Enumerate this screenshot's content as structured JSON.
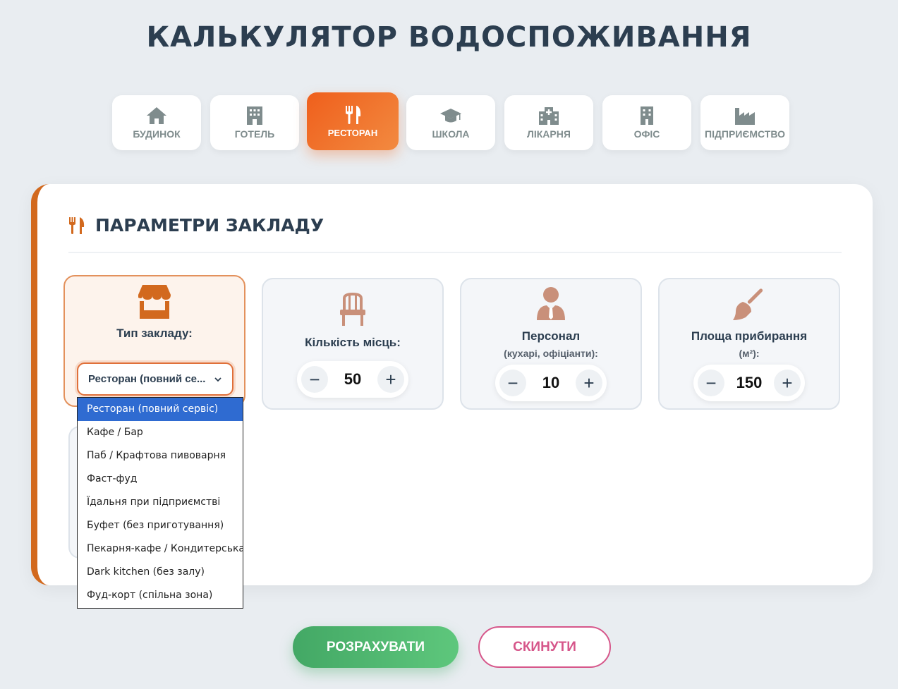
{
  "title": "КАЛЬКУЛЯТОР ВОДОСПОЖИВАННЯ",
  "tabs": [
    {
      "label": "БУДИНОК",
      "icon": "house-icon"
    },
    {
      "label": "ГОТЕЛЬ",
      "icon": "hotel-icon"
    },
    {
      "label": "РЕСТОРАН",
      "icon": "utensils-icon",
      "active": true
    },
    {
      "label": "ШКОЛА",
      "icon": "graduation-cap-icon"
    },
    {
      "label": "ЛІКАРНЯ",
      "icon": "hospital-icon"
    },
    {
      "label": "ОФІС",
      "icon": "office-building-icon"
    },
    {
      "label": "ПІДПРИЄМСТВО",
      "icon": "factory-icon"
    }
  ],
  "section": {
    "title": "ПАРАМЕТРИ ЗАКЛАДУ",
    "icon": "utensils-icon"
  },
  "params": {
    "type": {
      "label": "Тип закладу:",
      "icon": "store-icon",
      "selected": "Ресторан (повний се..."
    },
    "seats": {
      "label": "Кількість місць:",
      "icon": "chair-icon",
      "value": "50"
    },
    "staff": {
      "label": "Персонал",
      "sub": "(кухарі, офіціанти):",
      "icon": "user-tie-icon",
      "value": "10"
    },
    "area": {
      "label": "Площа прибирання",
      "sub": "(м²):",
      "icon": "broom-icon",
      "value": "150"
    }
  },
  "dropdown": {
    "options": [
      "Ресторан (повний сервіс)",
      "Кафе / Бар",
      "Паб / Крафтова пивоварня",
      "Фаст-фуд",
      "Їдальня при підприємстві",
      "Буфет (без приготування)",
      "Пекарня-кафе / Кондитерська",
      "Dark kitchen (без залу)",
      "Фуд-корт (спільна зона)"
    ],
    "selected_index": 0
  },
  "stepper": {
    "minus": "−",
    "plus": "+"
  },
  "actions": {
    "calculate": "РОЗРАХУВАТИ",
    "reset": "СКИНУТИ"
  },
  "colors": {
    "accent": "#ef5f1c",
    "icon_brown": "#d2691e",
    "icon_tan": "#c9907a",
    "green": "#43a865",
    "pink": "#d6568a"
  }
}
